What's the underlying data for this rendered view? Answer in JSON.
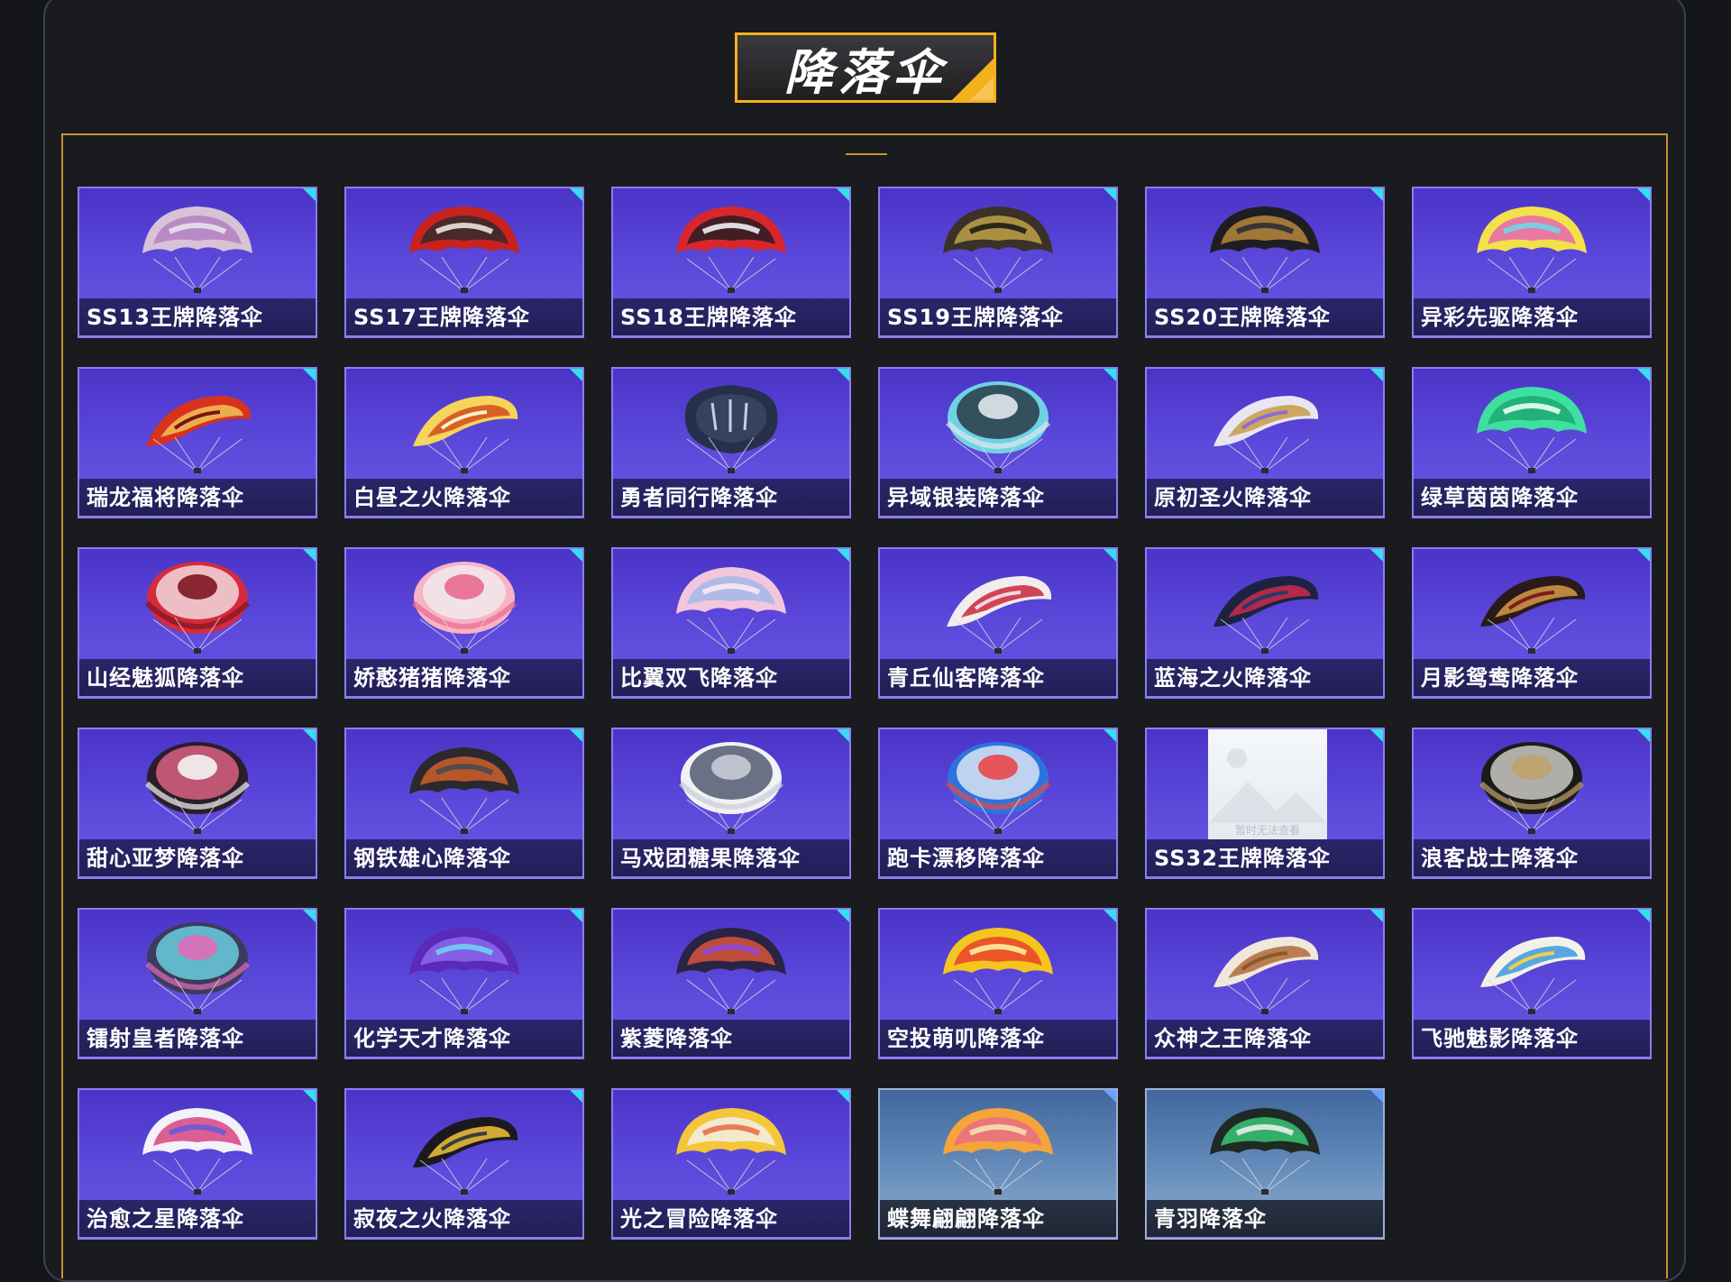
{
  "section_title": "降落伞",
  "placeholder_text": "暂时无法查看",
  "items": [
    {
      "label": "SS13王牌降落伞",
      "icon": "parachute-icon",
      "c1": "#d8c2d6",
      "c2": "#b07cc0",
      "c3": "#e7e2ea",
      "shape": "wide",
      "badge": "SS13",
      "alt": false
    },
    {
      "label": "SS17王牌降落伞",
      "icon": "parachute-icon",
      "c1": "#c8221f",
      "c2": "#2a2a2e",
      "c3": "#e9e3dd",
      "shape": "wide",
      "badge": "SS17",
      "alt": false
    },
    {
      "label": "SS18王牌降落伞",
      "icon": "parachute-icon",
      "c1": "#d8262d",
      "c2": "#1c1c22",
      "c3": "#f0f0f4",
      "shape": "wide",
      "badge": "SS18",
      "alt": false
    },
    {
      "label": "SS19王牌降落伞",
      "icon": "parachute-icon",
      "c1": "#3a3226",
      "c2": "#c9a74a",
      "c3": "#1e1c1a",
      "shape": "wide",
      "badge": "SS19",
      "alt": false
    },
    {
      "label": "SS20王牌降落伞",
      "icon": "parachute-icon",
      "c1": "#1e1e22",
      "c2": "#c08d3f",
      "c3": "#2e2e34",
      "shape": "wide",
      "badge": "SS20",
      "alt": false
    },
    {
      "label": "异彩先驱降落伞",
      "icon": "parachute-icon",
      "c1": "#f2e14a",
      "c2": "#e65fb8",
      "c3": "#6fd6e8",
      "shape": "wide",
      "badge": "",
      "alt": false
    },
    {
      "label": "瑞龙福将降落伞",
      "icon": "parachute-icon",
      "c1": "#d8321c",
      "c2": "#f0c35b",
      "c3": "#7a1410",
      "shape": "wing",
      "badge": "",
      "alt": false
    },
    {
      "label": "白昼之火降落伞",
      "icon": "parachute-icon",
      "c1": "#f4d45a",
      "c2": "#d44a1e",
      "c3": "#fff2c8",
      "shape": "wing",
      "badge": "",
      "alt": false
    },
    {
      "label": "勇者同行降落伞",
      "icon": "parachute-icon",
      "c1": "#27304a",
      "c2": "#3c4764",
      "c3": "#1c2234",
      "shape": "pillow",
      "badge": "勇者同行",
      "alt": false
    },
    {
      "label": "异域银装降落伞",
      "icon": "parachute-icon",
      "c1": "#6fd2e4",
      "c2": "#1f2630",
      "c3": "#dfe8ee",
      "shape": "round",
      "badge": "",
      "alt": false
    },
    {
      "label": "原初圣火降落伞",
      "icon": "parachute-icon",
      "c1": "#e9e6f1",
      "c2": "#c79b46",
      "c3": "#8e6bd6",
      "shape": "wing",
      "badge": "",
      "alt": false
    },
    {
      "label": "绿草茵茵降落伞",
      "icon": "parachute-icon",
      "c1": "#3ee0a0",
      "c2": "#1aa66f",
      "c3": "#e6fff2",
      "shape": "wide",
      "badge": "",
      "alt": false
    },
    {
      "label": "山经魅狐降落伞",
      "icon": "parachute-icon",
      "c1": "#d62a3d",
      "c2": "#f4f0f0",
      "c3": "#7e1522",
      "shape": "round",
      "badge": "",
      "alt": false
    },
    {
      "label": "娇憨猪猪降落伞",
      "icon": "parachute-icon",
      "c1": "#f7b3c4",
      "c2": "#f0f0f2",
      "c3": "#e86b8f",
      "shape": "round",
      "badge": "",
      "alt": false
    },
    {
      "label": "比翼双飞降落伞",
      "icon": "parachute-icon",
      "c1": "#f2c7dd",
      "c2": "#9fb6ea",
      "c3": "#fbe9f2",
      "shape": "wide",
      "badge": "",
      "alt": false
    },
    {
      "label": "青丘仙客降落伞",
      "icon": "parachute-icon",
      "c1": "#f3ecec",
      "c2": "#c8283c",
      "c3": "#f6d6df",
      "shape": "wing",
      "badge": "",
      "alt": false
    },
    {
      "label": "蓝海之火降落伞",
      "icon": "parachute-icon",
      "c1": "#1c2242",
      "c2": "#cc2a4a",
      "c3": "#2c3866",
      "shape": "wing",
      "badge": "",
      "alt": false
    },
    {
      "label": "月影鸳鸯降落伞",
      "icon": "parachute-icon",
      "c1": "#2a1a1a",
      "c2": "#d39a48",
      "c3": "#7d1c1c",
      "shape": "wing",
      "badge": "",
      "alt": false
    },
    {
      "label": "甜心亚梦降落伞",
      "icon": "parachute-icon",
      "c1": "#2a1e2a",
      "c2": "#f06a8e",
      "c3": "#f4f4f4",
      "shape": "round",
      "badge": "",
      "alt": false
    },
    {
      "label": "钢铁雄心降落伞",
      "icon": "parachute-icon",
      "c1": "#2a2a2e",
      "c2": "#d9632a",
      "c3": "#4a4a50",
      "shape": "wide",
      "badge": "",
      "alt": false
    },
    {
      "label": "马戏团糖果降落伞",
      "icon": "parachute-icon",
      "c1": "#f2f2f4",
      "c2": "#3c4660",
      "c3": "#c8ccd6",
      "shape": "round",
      "badge": "",
      "alt": false
    },
    {
      "label": "跑卡漂移降落伞",
      "icon": "parachute-icon",
      "c1": "#2a74e0",
      "c2": "#f2f2f4",
      "c3": "#e84848",
      "shape": "round",
      "badge": "",
      "alt": false
    },
    {
      "label": "SS32王牌降落伞",
      "icon": "image-placeholder-icon",
      "c1": "#f5f7fa",
      "c2": "#e4e9ef",
      "c3": "#b8bec8",
      "shape": "placeholder",
      "badge": "",
      "alt": false
    },
    {
      "label": "浪客战士降落伞",
      "icon": "parachute-icon",
      "c1": "#1c1a18",
      "c2": "#e2e0d8",
      "c3": "#bfa36a",
      "shape": "round",
      "badge": "",
      "alt": false
    },
    {
      "label": "镭射皇者降落伞",
      "icon": "parachute-icon",
      "c1": "#3c3c5a",
      "c2": "#6fe0f0",
      "c3": "#e06bb8",
      "shape": "round",
      "badge": "",
      "alt": false
    },
    {
      "label": "化学天才降落伞",
      "icon": "parachute-icon",
      "c1": "#5a2ab8",
      "c2": "#8e6bf0",
      "c3": "#6fd2f0",
      "shape": "wide",
      "badge": "",
      "alt": false
    },
    {
      "label": "紫菱降落伞",
      "icon": "parachute-icon",
      "c1": "#2a2444",
      "c2": "#e4563a",
      "c3": "#8e4ad6",
      "shape": "wide",
      "badge": "",
      "alt": false
    },
    {
      "label": "空投萌叽降落伞",
      "icon": "parachute-icon",
      "c1": "#f4c51e",
      "c2": "#e8382a",
      "c3": "#fff0a0",
      "shape": "wide",
      "badge": "",
      "alt": false
    },
    {
      "label": "众神之王降落伞",
      "icon": "parachute-icon",
      "c1": "#f0e8da",
      "c2": "#b06a3a",
      "c3": "#8a5a2a",
      "shape": "wing",
      "badge": "",
      "alt": false
    },
    {
      "label": "飞驰魅影降落伞",
      "icon": "parachute-icon",
      "c1": "#f4f2e8",
      "c2": "#3c9ae0",
      "c3": "#f0d04a",
      "shape": "wing",
      "badge": "",
      "alt": false
    },
    {
      "label": "治愈之星降落伞",
      "icon": "parachute-icon",
      "c1": "#f2f2f8",
      "c2": "#d63a7a",
      "c3": "#6a5ad8",
      "shape": "wide",
      "badge": "",
      "alt": false
    },
    {
      "label": "寂夜之火降落伞",
      "icon": "parachute-icon",
      "c1": "#1a1a1e",
      "c2": "#f2c43a",
      "c3": "#3a3a40",
      "shape": "wing",
      "badge": "",
      "alt": false
    },
    {
      "label": "光之冒险降落伞",
      "icon": "parachute-icon",
      "c1": "#f4c63a",
      "c2": "#f2f2f4",
      "c3": "#e8704a",
      "shape": "wide",
      "badge": "",
      "alt": false
    },
    {
      "label": "蝶舞翩翩降落伞",
      "icon": "parachute-icon",
      "c1": "#f4a43a",
      "c2": "#e86a8a",
      "c3": "#f8e0b0",
      "shape": "wide",
      "badge": "",
      "alt": true
    },
    {
      "label": "青羽降落伞",
      "icon": "parachute-icon",
      "c1": "#1e2a22",
      "c2": "#3ad07a",
      "c3": "#e6f0ea",
      "shape": "wide",
      "badge": "",
      "alt": true
    }
  ]
}
